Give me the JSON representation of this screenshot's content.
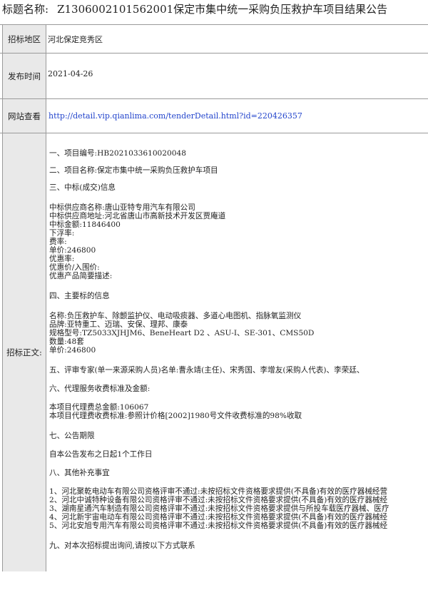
{
  "header": {
    "label": "标题名称:",
    "title": "Z1306002101562001保定市集中统一采购负压救护车项目结果公告"
  },
  "rows": {
    "region": {
      "label": "招标地区",
      "value": "河北保定竞秀区"
    },
    "date": {
      "label": "发布时间",
      "value": "2021-04-26"
    },
    "url": {
      "label": "网站查看",
      "value": "http://detail.vip.qianlima.com/tenderDetail.html?id=220426357"
    },
    "body": {
      "label": "招标正文:"
    }
  },
  "body_lines": [
    "一、项目编号:HB2021033610020048",
    "二、项目名称:保定市集中统一采购负压救护车项目",
    "三、中标(成交)信息",
    "中标供应商名称:唐山亚特专用汽车有限公司",
    "中标供应商地址:河北省唐山市高新技术开发区贾庵道",
    "中标金额:11846400",
    "下浮率:",
    "费率:",
    "单价:246800",
    "优惠率:",
    "优惠价/入围价:",
    "优惠产品简要描述:",
    "四、主要标的信息",
    "名称:负压救护车、除颤监护仪、电动吸痰器、多道心电图机、指脉氧监测仪",
    "品牌:亚特重工、迈瑞、安保、理邦、康泰",
    "规格型号:TZ5033XJHJM6、BeneHeart D2 、ASU-I、SE-301、CMS50D",
    "数量:48套",
    "单价:246800",
    "五、评审专家(单一来源采购人员)名单:曹永靖(主任)、宋秀国、李增友(采购人代表)、李荣廷、",
    "六、代理服务收费标准及金额:",
    "本项目代理费总金额:106067",
    "本项目代理费收费标准:参照计价格[2002]1980号文件收费标准的98%收取",
    "七、公告期限",
    "自本公告发布之日起1个工作日",
    "八、其他补充事宜",
    "1、河北聚乾电动车有限公司资格评审不通过:未按招标文件资格要求提供(不具备)有效的医疗器械经营",
    "2、河北中诚特种设备有限公司资格评审不通过:未按招标文件资格要求提供(不具备)有效的医疗器械经",
    "3、湖南星通汽车制造有限公司资格评审不通过:未按招标文件资格要求提供与所投车载医疗器械、医疗",
    "4、河北新宇宙电动车有限公司资格评审不通过:未按招标文件资格要求提供(不具备)有效的医疗器械经",
    "5、河北安旭专用汽车有限公司资格评审不通过:未按招标文件资格要求提供(不具备)有效的医疗器械经",
    "九、对本次招标提出询问,请按以下方式联系"
  ]
}
